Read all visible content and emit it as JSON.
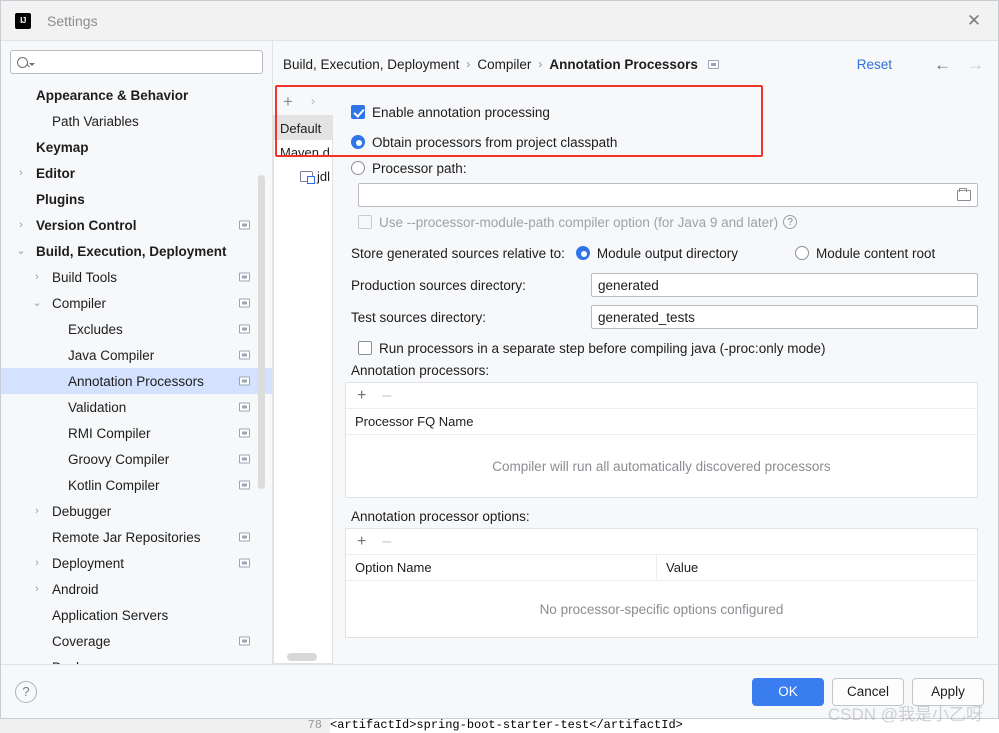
{
  "window": {
    "title": "Settings",
    "app_icon": "intellij-idea-icon",
    "close_icon": "close-icon"
  },
  "sidebar": {
    "search": {
      "placeholder": "",
      "value": "",
      "icon": "search-icon"
    },
    "items": [
      {
        "label": "Appearance & Behavior",
        "indent": 0,
        "arrow": "",
        "bold": true,
        "cfg": false,
        "selected": false
      },
      {
        "label": "Path Variables",
        "indent": 1,
        "arrow": "",
        "bold": false,
        "cfg": false,
        "selected": false
      },
      {
        "label": "Keymap",
        "indent": 0,
        "arrow": "",
        "bold": true,
        "cfg": false,
        "selected": false
      },
      {
        "label": "Editor",
        "indent": 0,
        "arrow": "›",
        "bold": true,
        "cfg": false,
        "selected": false
      },
      {
        "label": "Plugins",
        "indent": 0,
        "arrow": "",
        "bold": true,
        "cfg": false,
        "selected": false
      },
      {
        "label": "Version Control",
        "indent": 0,
        "arrow": "›",
        "bold": true,
        "cfg": true,
        "selected": false
      },
      {
        "label": "Build, Execution, Deployment",
        "indent": 0,
        "arrow": "⌄",
        "bold": true,
        "cfg": false,
        "selected": false
      },
      {
        "label": "Build Tools",
        "indent": 1,
        "arrow": "›",
        "bold": false,
        "cfg": true,
        "selected": false
      },
      {
        "label": "Compiler",
        "indent": 1,
        "arrow": "⌄",
        "bold": false,
        "cfg": true,
        "selected": false
      },
      {
        "label": "Excludes",
        "indent": 2,
        "arrow": "",
        "bold": false,
        "cfg": true,
        "selected": false
      },
      {
        "label": "Java Compiler",
        "indent": 2,
        "arrow": "",
        "bold": false,
        "cfg": true,
        "selected": false
      },
      {
        "label": "Annotation Processors",
        "indent": 2,
        "arrow": "",
        "bold": false,
        "cfg": true,
        "selected": true
      },
      {
        "label": "Validation",
        "indent": 2,
        "arrow": "",
        "bold": false,
        "cfg": true,
        "selected": false
      },
      {
        "label": "RMI Compiler",
        "indent": 2,
        "arrow": "",
        "bold": false,
        "cfg": true,
        "selected": false
      },
      {
        "label": "Groovy Compiler",
        "indent": 2,
        "arrow": "",
        "bold": false,
        "cfg": true,
        "selected": false
      },
      {
        "label": "Kotlin Compiler",
        "indent": 2,
        "arrow": "",
        "bold": false,
        "cfg": true,
        "selected": false
      },
      {
        "label": "Debugger",
        "indent": 1,
        "arrow": "›",
        "bold": false,
        "cfg": false,
        "selected": false
      },
      {
        "label": "Remote Jar Repositories",
        "indent": 1,
        "arrow": "",
        "bold": false,
        "cfg": true,
        "selected": false
      },
      {
        "label": "Deployment",
        "indent": 1,
        "arrow": "›",
        "bold": false,
        "cfg": true,
        "selected": false
      },
      {
        "label": "Android",
        "indent": 1,
        "arrow": "›",
        "bold": false,
        "cfg": false,
        "selected": false
      },
      {
        "label": "Application Servers",
        "indent": 1,
        "arrow": "",
        "bold": false,
        "cfg": false,
        "selected": false
      },
      {
        "label": "Coverage",
        "indent": 1,
        "arrow": "",
        "bold": false,
        "cfg": true,
        "selected": false
      },
      {
        "label": "Docker",
        "indent": 1,
        "arrow": "›",
        "bold": false,
        "cfg": false,
        "selected": false
      }
    ]
  },
  "header": {
    "breadcrumb": [
      "Build, Execution, Deployment",
      "Compiler",
      "Annotation Processors"
    ],
    "separator": "›",
    "config_icon": "project-settings-icon",
    "reset_label": "Reset",
    "back_arrow": "←",
    "forward_arrow": "→"
  },
  "profiles": {
    "add_label": "+",
    "chevron": "›",
    "items": [
      {
        "label": "Default",
        "selected": true,
        "icon": ""
      },
      {
        "label": "Maven d",
        "selected": false,
        "icon": ""
      },
      {
        "label": "jdl",
        "selected": false,
        "icon": "module-icon"
      }
    ]
  },
  "form": {
    "enable_annotation_processing": {
      "label": "Enable annotation processing",
      "checked": true
    },
    "source_mode": {
      "options": [
        {
          "label": "Obtain processors from project classpath",
          "selected": true
        },
        {
          "label": "Processor path:",
          "selected": false
        }
      ]
    },
    "processor_path": {
      "value": "",
      "placeholder": "",
      "browse_icon": "folder-icon"
    },
    "processor_module_path": {
      "label": "Use --processor-module-path compiler option (for Java 9 and later)",
      "checked": false,
      "disabled": true,
      "help_icon": "help-icon"
    },
    "store_relative": {
      "label": "Store generated sources relative to:",
      "options": [
        {
          "label": "Module output directory",
          "selected": true
        },
        {
          "label": "Module content root",
          "selected": false
        }
      ]
    },
    "production_sources": {
      "label": "Production sources directory:",
      "value": "generated"
    },
    "test_sources": {
      "label": "Test sources directory:",
      "value": "generated_tests"
    },
    "separate_step": {
      "label": "Run processors in a separate step before compiling java (-proc:only mode)",
      "checked": false
    },
    "processors_table": {
      "label": "Annotation processors:",
      "add_icon": "+",
      "remove_icon": "–",
      "columns": [
        "Processor FQ Name"
      ],
      "rows": [],
      "empty_text": "Compiler will run all automatically discovered processors"
    },
    "options_table": {
      "label": "Annotation processor options:",
      "add_icon": "+",
      "remove_icon": "–",
      "columns": [
        "Option Name",
        "Value"
      ],
      "rows": [],
      "empty_text": "No processor-specific options configured"
    }
  },
  "footer": {
    "help_icon": "?",
    "ok_label": "OK",
    "cancel_label": "Cancel",
    "apply_label": "Apply"
  },
  "overlay": {
    "watermark": "CSDN @我是小乙呀",
    "highlight_color": "#f3342b"
  },
  "background_code": {
    "line_number": "78",
    "text": "<artifactId>spring-boot-starter-test</artifactId>"
  }
}
